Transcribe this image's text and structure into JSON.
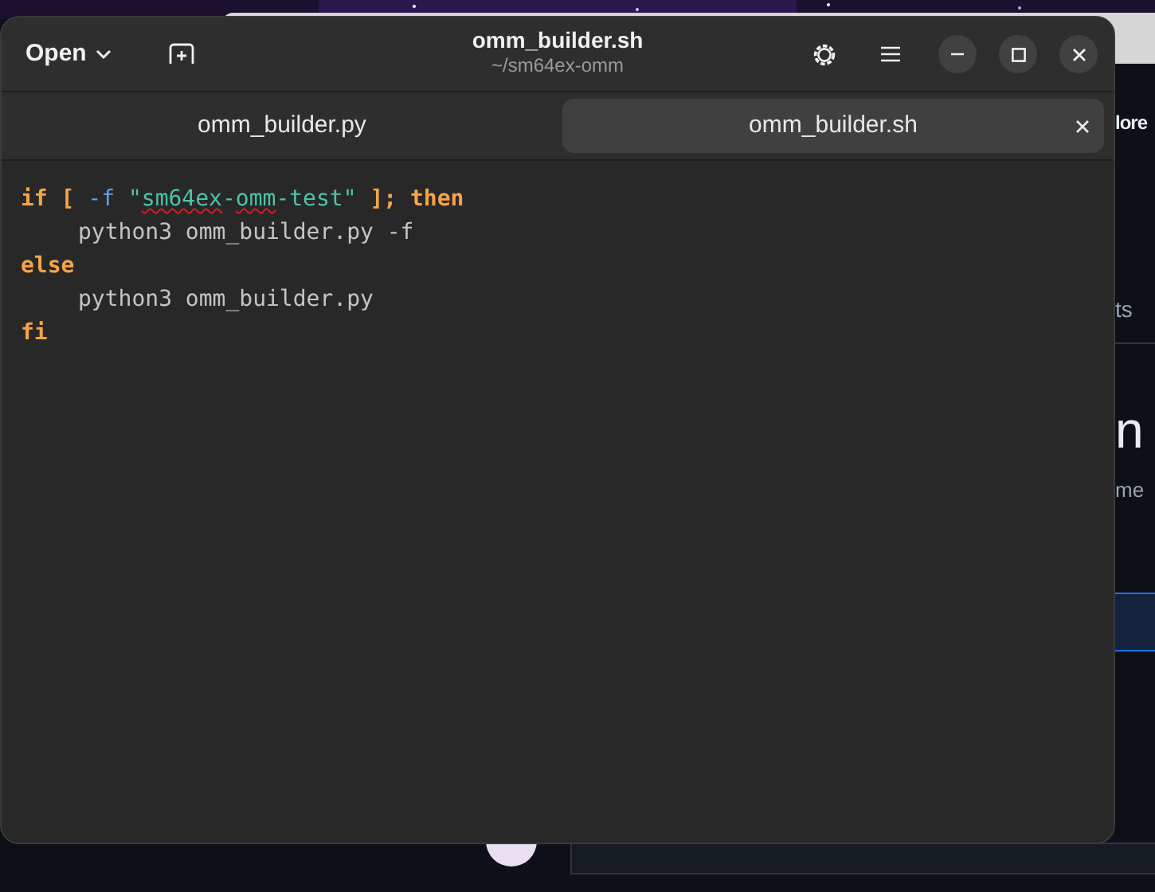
{
  "background_window": {
    "texts": [
      "lore",
      "ts",
      "n",
      "me"
    ]
  },
  "header": {
    "open_button": "Open",
    "title": "omm_builder.sh",
    "subtitle": "~/sm64ex-omm"
  },
  "tabs": [
    {
      "label": "omm_builder.py",
      "selected": false
    },
    {
      "label": "omm_builder.sh",
      "selected": true
    }
  ],
  "code_lines": [
    {
      "indented": false,
      "tokens": [
        {
          "text": "if [ ",
          "kind": "keyword",
          "misspelled": false
        },
        {
          "text": "-f ",
          "kind": "option",
          "misspelled": false
        },
        {
          "text": "\"",
          "kind": "string",
          "misspelled": false
        },
        {
          "text": "sm64ex",
          "kind": "string",
          "misspelled": true
        },
        {
          "text": "-",
          "kind": "string",
          "misspelled": false
        },
        {
          "text": "omm",
          "kind": "string",
          "misspelled": true
        },
        {
          "text": "-test\"",
          "kind": "string",
          "misspelled": false
        },
        {
          "text": " ]; then",
          "kind": "keyword",
          "misspelled": false
        }
      ]
    },
    {
      "indented": true,
      "tokens": [
        {
          "text": "python3 omm_builder.py -f",
          "kind": "plain",
          "misspelled": false
        }
      ]
    },
    {
      "indented": false,
      "tokens": [
        {
          "text": "else",
          "kind": "keyword",
          "misspelled": false
        }
      ]
    },
    {
      "indented": true,
      "tokens": [
        {
          "text": "python3 omm_builder.py",
          "kind": "plain",
          "misspelled": false
        }
      ]
    },
    {
      "indented": false,
      "tokens": [
        {
          "text": "fi",
          "kind": "keyword",
          "misspelled": false
        }
      ]
    }
  ]
}
